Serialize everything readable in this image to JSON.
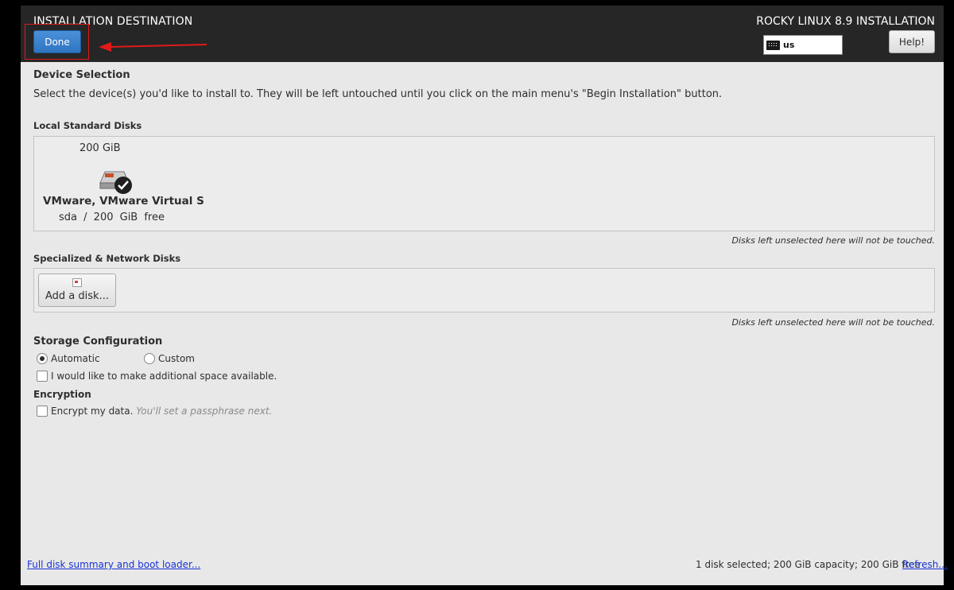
{
  "header": {
    "title": "INSTALLATION DESTINATION",
    "product": "ROCKY LINUX 8.9 INSTALLATION",
    "done_label": "Done",
    "keyboard_layout": "us",
    "help_label": "Help!",
    "annotation_color": "#e01a1a"
  },
  "device_selection": {
    "title": "Device Selection",
    "description": "Select the device(s) you'd like to install to.  They will be left untouched until you click on the main menu's \"Begin Installation\" button."
  },
  "local_disks": {
    "title": "Local Standard Disks",
    "disks": [
      {
        "size": "200 GiB",
        "name": "VMware, VMware Virtual S",
        "device": "sda",
        "separator": "/",
        "free": "200 GiB free",
        "selected": true,
        "icon": "hard-disk-selected-icon"
      }
    ],
    "note": "Disks left unselected here will not be touched."
  },
  "network_disks": {
    "title": "Specialized & Network Disks",
    "add_label": "Add a disk...",
    "note": "Disks left unselected here will not be touched."
  },
  "storage_config": {
    "title": "Storage Configuration",
    "automatic_label": "Automatic",
    "custom_label": "Custom",
    "selected": "Automatic",
    "additional_space_label": "I would like to make additional space available.",
    "additional_space_checked": false
  },
  "encryption": {
    "title": "Encryption",
    "encrypt_label": "Encrypt my data.",
    "encrypt_hint": "You'll set a passphrase next.",
    "encrypt_checked": false
  },
  "footer": {
    "summary_link": "Full disk summary and boot loader...",
    "status": "1 disk selected; 200 GiB capacity; 200 GiB free",
    "refresh_link": "Refresh..."
  },
  "colors": {
    "header_bg": "#262626",
    "content_bg": "#e8e8e8",
    "done_button": "#3b82cf",
    "link": "#1a32d8"
  }
}
